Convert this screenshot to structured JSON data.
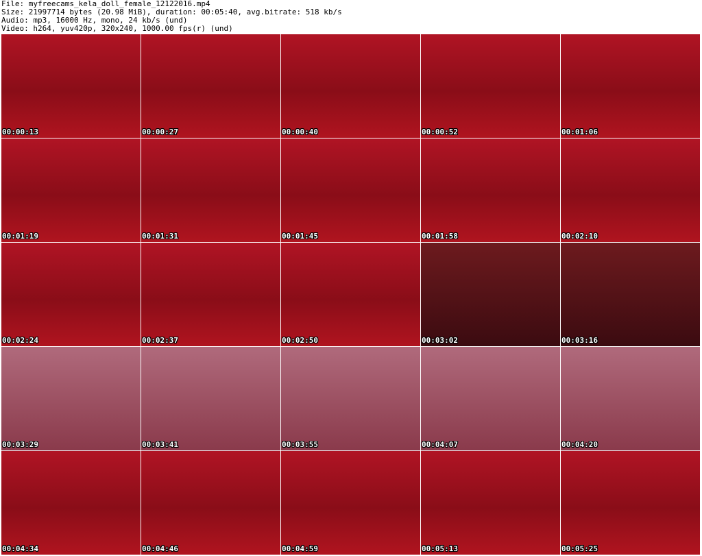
{
  "header": {
    "file_line": "File: myfreecams_kela_doll_female_12122016.mp4",
    "size_line": "Size: 21997714 bytes (20.98 MiB), duration: 00:05:40, avg.bitrate: 518 kb/s",
    "audio_line": "Audio: mp3, 16000 Hz, mono, 24 kb/s (und)",
    "video_line": "Video: h264, yuv420p, 320x240, 1000.00 fps(r) (und)"
  },
  "thumbnails": [
    {
      "timestamp": "00:00:13",
      "style": "red"
    },
    {
      "timestamp": "00:00:27",
      "style": "red"
    },
    {
      "timestamp": "00:00:40",
      "style": "red"
    },
    {
      "timestamp": "00:00:52",
      "style": "red"
    },
    {
      "timestamp": "00:01:06",
      "style": "red"
    },
    {
      "timestamp": "00:01:19",
      "style": "red"
    },
    {
      "timestamp": "00:01:31",
      "style": "red"
    },
    {
      "timestamp": "00:01:45",
      "style": "red"
    },
    {
      "timestamp": "00:01:58",
      "style": "red"
    },
    {
      "timestamp": "00:02:10",
      "style": "red"
    },
    {
      "timestamp": "00:02:24",
      "style": "red"
    },
    {
      "timestamp": "00:02:37",
      "style": "red"
    },
    {
      "timestamp": "00:02:50",
      "style": "red"
    },
    {
      "timestamp": "00:03:02",
      "style": "dark"
    },
    {
      "timestamp": "00:03:16",
      "style": "dark"
    },
    {
      "timestamp": "00:03:29",
      "style": "pink"
    },
    {
      "timestamp": "00:03:41",
      "style": "pink"
    },
    {
      "timestamp": "00:03:55",
      "style": "pink"
    },
    {
      "timestamp": "00:04:07",
      "style": "pink"
    },
    {
      "timestamp": "00:04:20",
      "style": "pink"
    },
    {
      "timestamp": "00:04:34",
      "style": "red"
    },
    {
      "timestamp": "00:04:46",
      "style": "red"
    },
    {
      "timestamp": "00:04:59",
      "style": "red"
    },
    {
      "timestamp": "00:05:13",
      "style": "red"
    },
    {
      "timestamp": "00:05:25",
      "style": "red"
    }
  ]
}
